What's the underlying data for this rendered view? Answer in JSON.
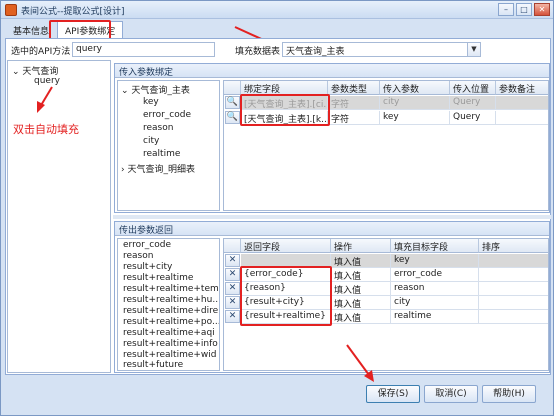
{
  "window": {
    "title": "表间公式--提取公式[设计]"
  },
  "tabs": [
    {
      "label": "基本信息",
      "active": false
    },
    {
      "label": "API参数绑定",
      "active": true
    }
  ],
  "api_method": {
    "label": "选中的API方法",
    "value": "query"
  },
  "fill_table": {
    "label": "填充数据表",
    "value": "天气查询_主表"
  },
  "left_tree": {
    "root": "天气查询",
    "child": "query"
  },
  "annotation": "双击自动填充",
  "input_params": {
    "title": "传入参数绑定",
    "tree": {
      "main": "天气查询_主表",
      "fields": [
        "key",
        "error_code",
        "reason",
        "city",
        "realtime"
      ],
      "detail": "天气查询_明细表"
    },
    "columns": [
      "绑定字段",
      "参数类型",
      "传入参数",
      "传入位置",
      "参数备注"
    ],
    "rows": [
      {
        "field": "[天气查询_主表].[ci...",
        "type": "字符",
        "param": "city",
        "position": "Query",
        "note": ""
      },
      {
        "field": "[天气查询_主表].[k...",
        "type": "字符",
        "param": "key",
        "position": "Query",
        "note": ""
      }
    ]
  },
  "output_params": {
    "title": "传出参数返回",
    "fields": [
      "error_code",
      "reason",
      "result+city",
      "result+realtime",
      "result+realtime+tem...",
      "result+realtime+hu...",
      "result+realtime+dire...",
      "result+realtime+po...",
      "result+realtime+aqi",
      "result+realtime+info",
      "result+realtime+wid",
      "result+future"
    ],
    "columns": [
      "返回字段",
      "操作",
      "填充目标字段",
      "排序"
    ],
    "rows": [
      {
        "field": "",
        "op": "填入值",
        "target": "key",
        "sort": ""
      },
      {
        "field": "{error_code}",
        "op": "填入值",
        "target": "error_code",
        "sort": ""
      },
      {
        "field": "{reason}",
        "op": "填入值",
        "target": "reason",
        "sort": ""
      },
      {
        "field": "{result+city}",
        "op": "填入值",
        "target": "city",
        "sort": ""
      },
      {
        "field": "{result+realtime}",
        "op": "填入值",
        "target": "realtime",
        "sort": ""
      }
    ]
  },
  "buttons": {
    "save": "保存(S)",
    "cancel": "取消(C)",
    "help": "帮助(H)"
  },
  "colors": {
    "annotation": "#e32121",
    "frame": "#92acd6"
  }
}
